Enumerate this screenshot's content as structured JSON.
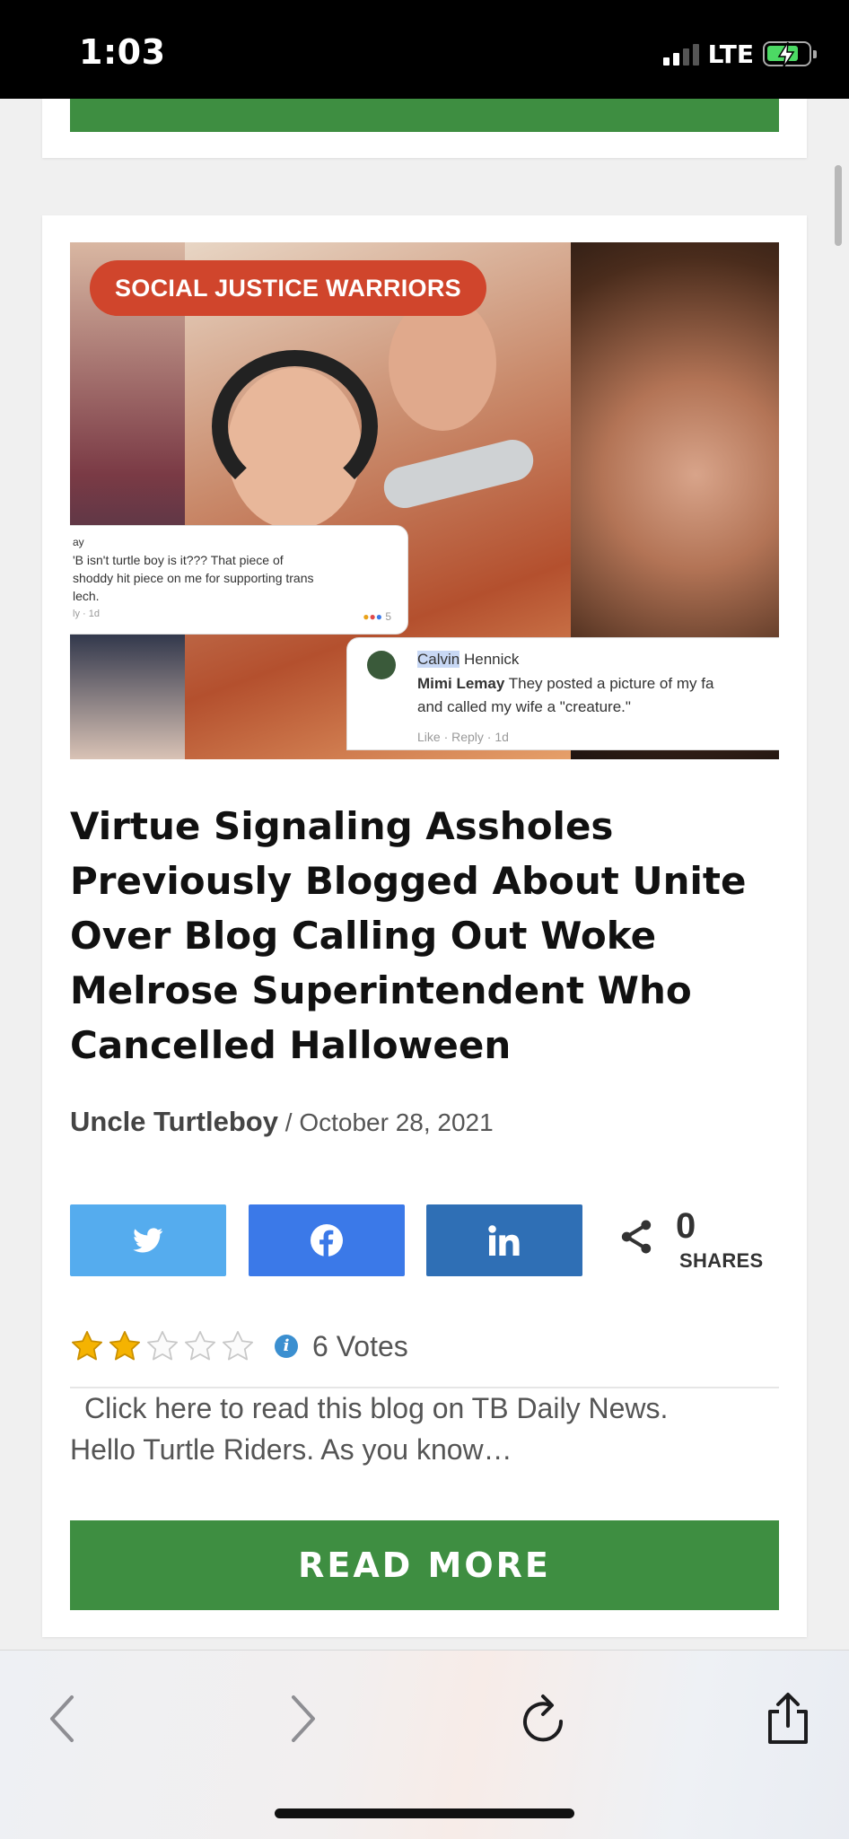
{
  "status_bar": {
    "time": "1:03",
    "network": "LTE",
    "battery_level": 0.75,
    "charging": true,
    "signal_bars": 2
  },
  "post": {
    "category": "SOCIAL JUSTICE WARRIORS",
    "image_comments": {
      "comment1": {
        "lines": [
          "ay",
          "'B isn't turtle boy is it??? That piece of",
          "shoddy hit piece on me for supporting trans",
          "lech."
        ],
        "meta": "ly · 1d",
        "reaction_count": "5"
      },
      "comment2": {
        "reply_to": "Calvin",
        "reply_to_rest": " Hennick",
        "author": "Mimi Lemay",
        "text_line1": " They posted a picture of my fa",
        "text_line2": "and called my wife a \"creature.\"",
        "actions": "Like · Reply · 1d"
      }
    },
    "title": "Virtue Signaling Assholes Previously Blogged About Unite Over Blog Calling Out Woke Melrose Superintendent Who Cancelled Halloween",
    "author": "Uncle Turtleboy",
    "separator": " / ",
    "date": "October 28, 2021",
    "shares": {
      "count": "0",
      "label": "SHARES"
    },
    "rating": {
      "value": 2,
      "max": 5,
      "votes": "6 Votes"
    },
    "excerpt_line1": "Click here to read this blog on TB Daily News.",
    "excerpt_line2": "Hello Turtle Riders. As you know…",
    "read_more": "READ MORE"
  },
  "colors": {
    "green": "#3e8e41",
    "badge_red": "#d0452c",
    "twitter": "#55acee",
    "facebook": "#3b79e8",
    "linkedin": "#2f6fb5",
    "star": "#f5b301"
  },
  "toolbar_icons": [
    "back-icon",
    "forward-icon",
    "reload-icon",
    "share-icon"
  ]
}
